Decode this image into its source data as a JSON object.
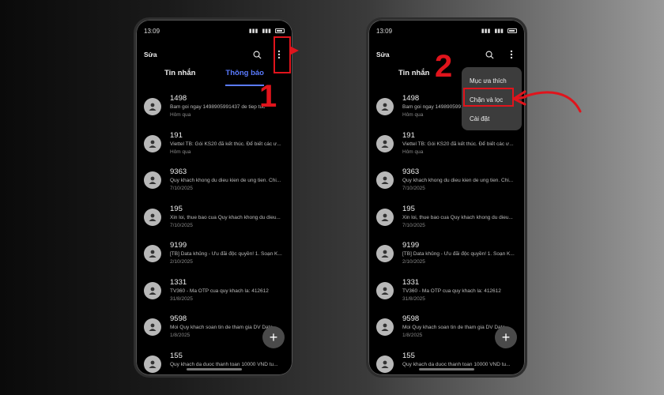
{
  "status": {
    "time": "13:09"
  },
  "appbar": {
    "edit_label": "Sửa"
  },
  "tabs": [
    {
      "label": "Tin nhắn",
      "active": false
    },
    {
      "label": "Thông báo",
      "active": true
    }
  ],
  "messages": [
    {
      "sender": "1498",
      "preview": "Bam goi ngay 1498905991437 de tiep tuc",
      "date": "Hôm qua"
    },
    {
      "sender": "191",
      "preview": "Viettel TB: Gói KS20 đã kết thúc. Để biết các ư...",
      "date": "Hôm qua"
    },
    {
      "sender": "9363",
      "preview": "Quy khach khong du dieu kien de ung tien. Chi...",
      "date": "7/10/2025"
    },
    {
      "sender": "195",
      "preview": "Xin loi, thue bao cua Quy khach khong du dieu...",
      "date": "7/10/2025"
    },
    {
      "sender": "9199",
      "preview": "[TB] Data khủng - Ưu đãi độc quyền! 1. Soạn K...",
      "date": "2/10/2025"
    },
    {
      "sender": "1331",
      "preview": "TV360 - Ma OTP cua quy khach la: 412612",
      "date": "31/8/2025"
    },
    {
      "sender": "9598",
      "preview": "Moi Quy khach soan tin de tham gia DV Data...",
      "date": "1/8/2025"
    },
    {
      "sender": "155",
      "preview": "Quy khach da duoc thanh toan 10000 VND tu...",
      "date": ""
    }
  ],
  "menu": {
    "items": [
      "Mục ưa thích",
      "Chặn và lọc",
      "Cài đặt"
    ]
  },
  "steps": {
    "step1": "1",
    "step2": "2"
  },
  "fab_label": "+",
  "colors": {
    "accent": "#5a7bff",
    "annotation": "#e0141c",
    "menu_bg": "#3c3c3c"
  }
}
